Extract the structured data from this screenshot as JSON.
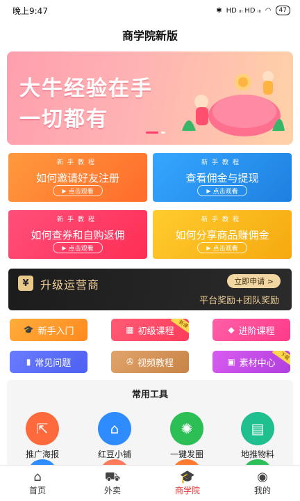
{
  "status_bar": {
    "time": "晚上9:47",
    "network": "HD ᵢₗₗ HD ᵢₗₗ",
    "battery": "47"
  },
  "header": {
    "title": "商学院新版"
  },
  "banner": {
    "line1": "大牛经验在手",
    "line2": "一切都有"
  },
  "cards": [
    {
      "tag": "新手教程",
      "title": "如何邀请好友注册",
      "button": "点击观看",
      "color": "#ff7a2e"
    },
    {
      "tag": "新手教程",
      "title": "查看佣金与提现",
      "button": "点击观看",
      "color": "#2a92f0"
    },
    {
      "tag": "新手教程",
      "title": "如何查券和自购返佣",
      "button": "点击观看",
      "color": "#ff3b62"
    },
    {
      "tag": "新手教程",
      "title": "如何分享商品赚佣金",
      "button": "点击观看",
      "color": "#f7b51b"
    }
  ],
  "upgrade": {
    "icon": "¥",
    "title": "升级运营商",
    "apply": "立即申请 >",
    "subtitle": "平台奖励+团队奖励"
  },
  "quick_links": [
    {
      "label": "新手入门",
      "icon": "graduation-cap-icon"
    },
    {
      "label": "初级课程",
      "icon": "grid-icon",
      "corner": "新课"
    },
    {
      "label": "进阶课程",
      "icon": "diamond-icon"
    },
    {
      "label": "常见问题",
      "icon": "bar-chart-icon"
    },
    {
      "label": "视频教程",
      "icon": "film-reel-icon"
    },
    {
      "label": "素材中心",
      "icon": "image-icon",
      "corner": "下载"
    }
  ],
  "tools": {
    "title": "常用工具",
    "items": [
      {
        "label": "推广海报",
        "icon": "share-icon",
        "color": "#ff6a3d"
      },
      {
        "label": "红豆小铺",
        "icon": "store-icon",
        "color": "#2f8cff"
      },
      {
        "label": "一键发圈",
        "icon": "camera-aperture-icon",
        "color": "#2bbf56"
      },
      {
        "label": "地推物料",
        "icon": "box-icon",
        "color": "#1fbf8f"
      }
    ]
  },
  "tabbar": [
    {
      "label": "首页",
      "icon": "home-icon",
      "active": false
    },
    {
      "label": "外卖",
      "icon": "scooter-icon",
      "active": false
    },
    {
      "label": "商学院",
      "icon": "graduation-cap-icon",
      "active": true
    },
    {
      "label": "我的",
      "icon": "user-icon",
      "active": false
    }
  ]
}
